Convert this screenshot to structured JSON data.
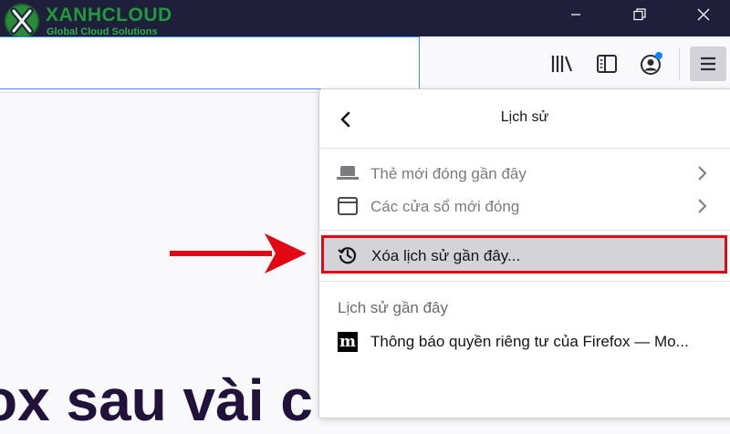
{
  "branding": {
    "name": "XANHCLOUD",
    "tagline": "Global Cloud Solutions",
    "colors": {
      "green": "#1f9b3a",
      "light_green": "#2bb04a"
    }
  },
  "window_controls": [
    "minimize-icon",
    "restore-icon",
    "close-icon"
  ],
  "toolbar": {
    "icons": [
      "library-icon",
      "sidebar-icon",
      "account-icon",
      "menu-icon"
    ],
    "account_badge_color": "#0a84ff"
  },
  "page": {
    "visible_text": "ox sau vài c"
  },
  "panel": {
    "title": "Lịch sử",
    "back_icon": "chevron-left-icon",
    "items": [
      {
        "label": "Thẻ mới đóng gần đây",
        "icon": "tab-icon",
        "has_submenu": true,
        "enabled": false
      },
      {
        "label": "Các cửa sổ mới đóng",
        "icon": "window-icon",
        "has_submenu": true,
        "enabled": false
      }
    ],
    "clear_history": {
      "label": "Xóa lịch sử gần đây...",
      "icon": "history-icon",
      "highlight_color": "#e30613"
    },
    "recent_section_label": "Lịch sử gần đây",
    "recent_items": [
      {
        "favicon": "m",
        "label": "Thông báo quyền riêng tư của Firefox — Mo..."
      }
    ]
  },
  "annotation": {
    "arrow_color": "#e30613"
  }
}
